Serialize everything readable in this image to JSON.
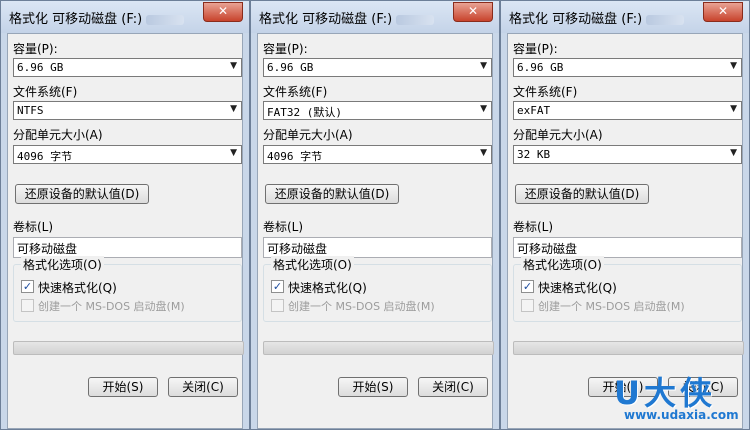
{
  "close_glyph": "✕",
  "checkmark": "✓",
  "dropdown_arrow": "▼",
  "windows": [
    {
      "title": "格式化 可移动磁盘 (F:)",
      "capacity_label": "容量(P):",
      "capacity_value": "6.96 GB",
      "filesystem_label": "文件系统(F)",
      "filesystem_value": "NTFS",
      "allocation_label": "分配单元大小(A)",
      "allocation_value": "4096 字节",
      "restore_button": "还原设备的默认值(D)",
      "volume_label": "卷标(L)",
      "volume_value": "可移动磁盘",
      "format_options_label": "格式化选项(O)",
      "quick_format_label": "快速格式化(Q)",
      "quick_format_checked": true,
      "msdos_label": "创建一个 MS-DOS 启动盘(M)",
      "msdos_checked": false,
      "start_button": "开始(S)",
      "close_button": "关闭(C)"
    },
    {
      "title": "格式化 可移动磁盘 (F:)",
      "capacity_label": "容量(P):",
      "capacity_value": "6.96 GB",
      "filesystem_label": "文件系统(F)",
      "filesystem_value": "FAT32 (默认)",
      "allocation_label": "分配单元大小(A)",
      "allocation_value": "4096 字节",
      "restore_button": "还原设备的默认值(D)",
      "volume_label": "卷标(L)",
      "volume_value": "可移动磁盘",
      "format_options_label": "格式化选项(O)",
      "quick_format_label": "快速格式化(Q)",
      "quick_format_checked": true,
      "msdos_label": "创建一个 MS-DOS 启动盘(M)",
      "msdos_checked": false,
      "start_button": "开始(S)",
      "close_button": "关闭(C)"
    },
    {
      "title": "格式化 可移动磁盘 (F:)",
      "capacity_label": "容量(P):",
      "capacity_value": "6.96 GB",
      "filesystem_label": "文件系统(F)",
      "filesystem_value": "exFAT",
      "allocation_label": "分配单元大小(A)",
      "allocation_value": "32 KB",
      "restore_button": "还原设备的默认值(D)",
      "volume_label": "卷标(L)",
      "volume_value": "可移动磁盘",
      "format_options_label": "格式化选项(O)",
      "quick_format_label": "快速格式化(Q)",
      "quick_format_checked": true,
      "msdos_label": "创建一个 MS-DOS 启动盘(M)",
      "msdos_checked": false,
      "start_button": "开始(S)",
      "close_button": "关闭(C)"
    }
  ],
  "watermark": {
    "logo_text": "U大侠",
    "url": "www.udaxia.com"
  }
}
